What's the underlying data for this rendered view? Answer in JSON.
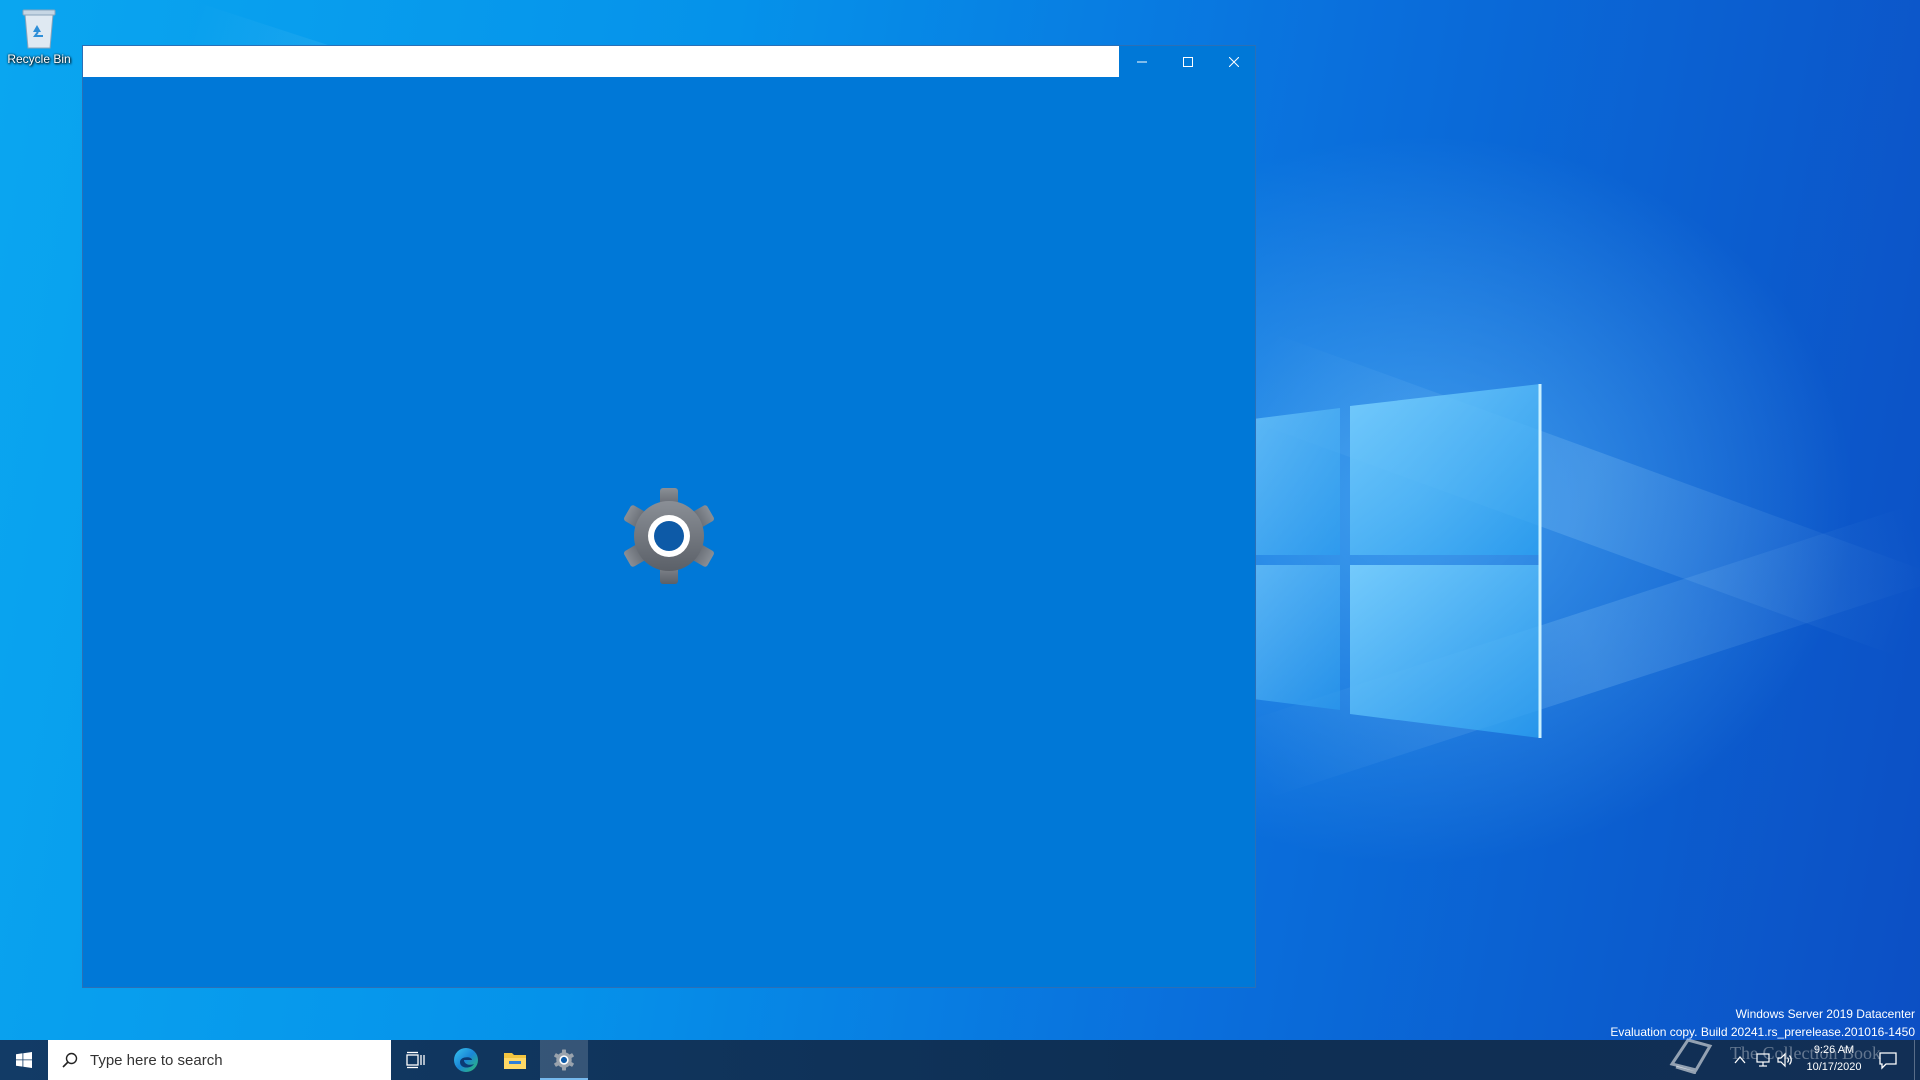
{
  "desktop": {
    "recycle_bin_label": "Recycle Bin",
    "watermark_line1": "Windows Server 2019 Datacenter",
    "watermark_line2": "Evaluation copy. Build 20241.rs_prerelease.201016-1450"
  },
  "window": {
    "title_value": "",
    "minimize_icon": "minimize-icon",
    "maximize_icon": "maximize-icon",
    "close_icon": "close-icon",
    "splash_icon": "gear-icon"
  },
  "taskbar": {
    "search_placeholder": "Type here to search",
    "pinned": [
      "task-view",
      "edge",
      "file-explorer",
      "settings"
    ],
    "clock_time": "9:26 AM",
    "clock_date": "10/17/2020",
    "watermark": "The Collection Book"
  },
  "colors": {
    "window_bg": "#0078d7",
    "taskbar_bg": "#123b66",
    "accent": "#0078d7"
  }
}
